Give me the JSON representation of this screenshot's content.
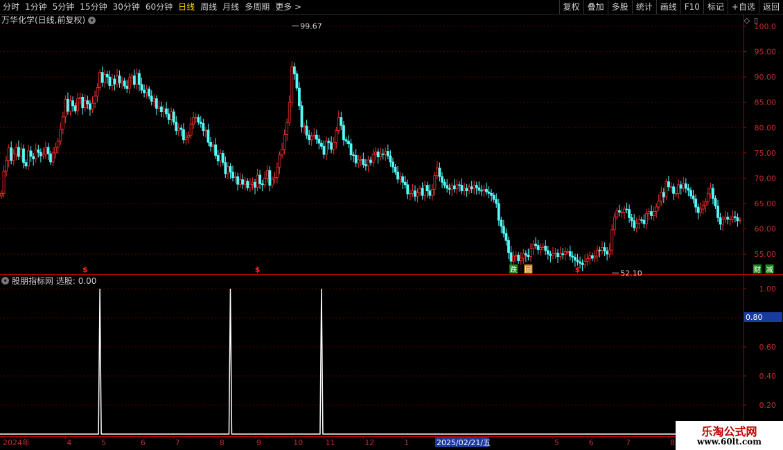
{
  "toolbar": {
    "tabs": [
      "分时",
      "1分钟",
      "5分钟",
      "15分钟",
      "30分钟",
      "60分钟",
      "日线",
      "周线",
      "月线",
      "多周期",
      "更多 >"
    ],
    "active_tab": "日线",
    "right_tools": [
      "复权",
      "叠加",
      "多股",
      "统计",
      "画线",
      "F10",
      "标记",
      "+自选",
      "返回"
    ]
  },
  "main_title": "万华化学(日线,前复权)",
  "indicator_title": "股朋指标网",
  "indicator_value": "选股: 0.00",
  "cursor_date": "2025/02/21/五",
  "watermark": {
    "line1": "乐淘公式网",
    "line2": "www.60lt.com"
  },
  "colors": {
    "up": "#ff3030",
    "down": "#54fcfc",
    "axis": "#b00000",
    "indicator": "#ffffff"
  },
  "chart_data": [
    {
      "type": "candlestick",
      "ylim": [
        52,
        100
      ],
      "yticks": [
        "100.0",
        "95.00",
        "90.00",
        "85.00",
        "80.00",
        "75.00",
        "70.00",
        "65.00",
        "60.00",
        "55.00"
      ],
      "ytick_values": [
        100,
        95,
        90,
        85,
        80,
        75,
        70,
        65,
        60,
        55
      ],
      "x_ticks": [
        {
          "label": "2024年",
          "i": 0
        },
        {
          "label": "4",
          "i": 26
        },
        {
          "label": "5",
          "i": 40
        },
        {
          "label": "6",
          "i": 56
        },
        {
          "label": "7",
          "i": 70
        },
        {
          "label": "8",
          "i": 88
        },
        {
          "label": "9",
          "i": 103
        },
        {
          "label": "10",
          "i": 118
        },
        {
          "label": "11",
          "i": 131
        },
        {
          "label": "12",
          "i": 147
        },
        {
          "label": "1",
          "i": 163
        },
        {
          "label": "2",
          "i": 177
        },
        {
          "label": "5",
          "i": 224
        },
        {
          "label": "6",
          "i": 238
        },
        {
          "label": "7",
          "i": 253
        },
        {
          "label": "8",
          "i": 271
        },
        {
          "label": "9",
          "i": 286
        }
      ],
      "high_label": {
        "text": "99.67",
        "i": 118,
        "value": 99.67
      },
      "low_label": {
        "text": "52.10",
        "i": 248,
        "value": 52.1
      },
      "markers": [
        {
          "text": "$",
          "i": 34,
          "kind": "dollar"
        },
        {
          "text": "$",
          "i": 104,
          "kind": "dollar"
        },
        {
          "text": "跌",
          "i": 208,
          "kind": "green"
        },
        {
          "text": "回",
          "i": 214,
          "kind": "orange"
        },
        {
          "text": "$",
          "i": 234,
          "kind": "dollar"
        },
        {
          "text": "财",
          "i": 307,
          "kind": "green"
        },
        {
          "text": "减",
          "i": 312,
          "kind": "green"
        }
      ],
      "closes": [
        67.0,
        71.4,
        73.5,
        76.0,
        73.5,
        74.8,
        76.1,
        74.3,
        75.8,
        73.1,
        72.4,
        75.4,
        74.3,
        73.8,
        75.6,
        75.1,
        74.4,
        74.7,
        76.1,
        74.8,
        73.2,
        75.0,
        76.1,
        77.3,
        79.7,
        82.1,
        85.6,
        83.2,
        85.3,
        84.3,
        83.3,
        85.7,
        86.0,
        83.9,
        85.3,
        84.7,
        83.6,
        84.8,
        86.2,
        87.9,
        90.9,
        88.9,
        90.5,
        90.0,
        88.3,
        89.6,
        88.6,
        90.2,
        88.8,
        89.2,
        88.2,
        87.7,
        89.8,
        90.2,
        88.5,
        90.7,
        88.5,
        87.4,
        86.9,
        87.6,
        86.2,
        85.2,
        85.7,
        83.8,
        84.1,
        83.1,
        83.7,
        82.7,
        81.6,
        83.1,
        81.1,
        79.4,
        79.9,
        79.6,
        77.6,
        78.1,
        78.5,
        80.7,
        82.0,
        82.0,
        81.1,
        80.8,
        79.4,
        79.5,
        77.1,
        76.3,
        76.6,
        74.5,
        73.4,
        74.9,
        73.1,
        70.9,
        72.3,
        71.2,
        70.1,
        70.3,
        68.8,
        69.7,
        68.8,
        69.4,
        68.1,
        68.8,
        69.2,
        68.2,
        70.6,
        68.9,
        68.7,
        70.0,
        71.5,
        68.6,
        69.8,
        70.1,
        72.2,
        74.6,
        75.7,
        78.6,
        81.0,
        85.0,
        92.0,
        90.6,
        87.8,
        84.3,
        80.1,
        80.3,
        78.5,
        77.6,
        78.3,
        78.5,
        77.7,
        76.9,
        76.3,
        74.7,
        77.3,
        77.0,
        75.7,
        77.1,
        79.4,
        82.0,
        80.4,
        77.6,
        77.3,
        76.8,
        74.6,
        74.5,
        73.0,
        73.6,
        73.7,
        72.7,
        72.4,
        73.6,
        73.1,
        74.7,
        75.2,
        74.2,
        74.8,
        74.7,
        75.3,
        74.4,
        73.2,
        72.2,
        71.2,
        69.8,
        70.3,
        69.2,
        68.7,
        66.9,
        67.0,
        67.5,
        66.4,
        67.1,
        68.0,
        66.6,
        68.6,
        67.5,
        66.6,
        67.8,
        70.5,
        72.0,
        70.3,
        69.2,
        68.6,
        68.0,
        67.8,
        68.5,
        67.9,
        68.7,
        68.6,
        67.5,
        68.0,
        67.5,
        68.3,
        67.9,
        68.6,
        68.1,
        67.6,
        67.5,
        67.8,
        67.3,
        67.0,
        66.6,
        65.8,
        65.0,
        61.7,
        60.5,
        59.1,
        57.7,
        55.3,
        53.6,
        54.6,
        54.8,
        53.7,
        54.2,
        55.1,
        54.8,
        54.5,
        56.1,
        57.0,
        56.7,
        55.9,
        56.3,
        56.6,
        55.7,
        55.0,
        54.7,
        55.1,
        55.2,
        54.5,
        55.1,
        54.9,
        55.5,
        55.5,
        54.6,
        54.4,
        53.8,
        53.5,
        53.2,
        52.9,
        53.6,
        54.1,
        54.7,
        54.2,
        54.6,
        55.8,
        55.7,
        56.3,
        55.6,
        55.0,
        55.8,
        59.8,
        62.3,
        63.6,
        63.3,
        63.3,
        63.9,
        63.8,
        62.2,
        61.6,
        60.2,
        61.1,
        61.8,
        61.7,
        61.0,
        63.0,
        63.4,
        62.6,
        63.4,
        64.3,
        65.5,
        67.2,
        66.3,
        69.3,
        68.3,
        68.3,
        67.0,
        67.0,
        68.7,
        68.0,
        68.9,
        68.0,
        67.6,
        66.5,
        65.9,
        64.3,
        63.2,
        63.9,
        64.6,
        65.3,
        66.9,
        68.0,
        66.0,
        64.5,
        62.2,
        60.9,
        61.9,
        62.3,
        61.9,
        61.9,
        62.4,
        62.2,
        61.6,
        61.7
      ]
    },
    {
      "type": "line",
      "series": [
        {
          "name": "选股",
          "spikes": [
            {
              "i": 40,
              "value": 1.0
            },
            {
              "i": 93,
              "value": 1.0
            },
            {
              "i": 130,
              "value": 1.0
            }
          ],
          "baseline": 0.0
        }
      ],
      "ylim": [
        0.1,
        1.05
      ],
      "yticks": [
        "1.00",
        "0.80",
        "0.60",
        "0.40",
        "0.20"
      ],
      "ytick_values": [
        1.0,
        0.8,
        0.6,
        0.4,
        0.2
      ],
      "cursor_value": "0.80"
    }
  ]
}
